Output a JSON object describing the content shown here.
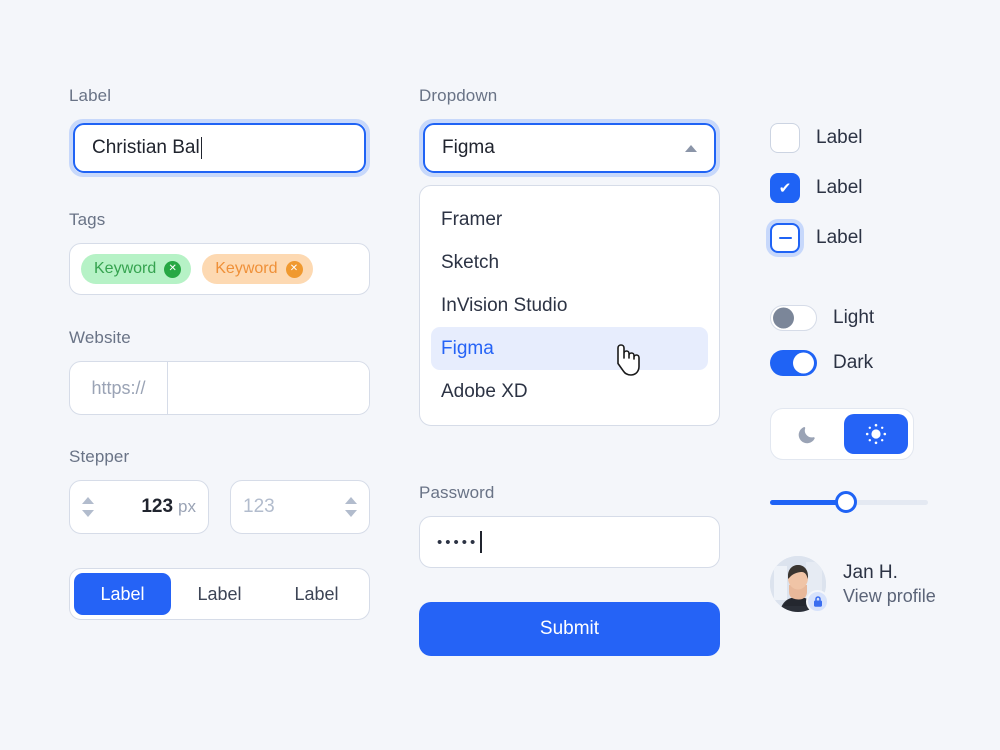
{
  "theme": {
    "accent": "#2563f6",
    "accent_border": "#1f63f5",
    "focus_ring": "#c7d8fb",
    "page_bg": "#f4f6fa",
    "label_color": "#697386",
    "text_color": "#2c3344",
    "tag_green_bg": "#b6f2c6",
    "tag_green_fg": "#35a34f",
    "tag_orange_bg": "#fdd9b2",
    "tag_orange_fg": "#ef9038"
  },
  "left": {
    "label_field": {
      "label": "Label",
      "value": "Christian Bal",
      "focused": true
    },
    "tags": {
      "label": "Tags",
      "items": [
        {
          "text": "Keyword",
          "color": "green",
          "remove_icon": "✕"
        },
        {
          "text": "Keyword",
          "color": "orange",
          "remove_icon": "✕"
        }
      ]
    },
    "website": {
      "label": "Website",
      "prefix": "https://",
      "value": "",
      "placeholder": ""
    },
    "stepper": {
      "label": "Stepper",
      "primary": {
        "value": "123",
        "unit": "px"
      },
      "secondary": {
        "placeholder": "123"
      }
    },
    "segmented": {
      "options": [
        {
          "label": "Label",
          "active": true
        },
        {
          "label": "Label",
          "active": false
        },
        {
          "label": "Label",
          "active": false
        }
      ]
    }
  },
  "middle": {
    "dropdown": {
      "label": "Dropdown",
      "selected": "Figma",
      "expanded": true,
      "caret_icon": "chevron-up-icon",
      "options": [
        {
          "label": "Framer",
          "selected": false
        },
        {
          "label": "Sketch",
          "selected": false
        },
        {
          "label": "InVision Studio",
          "selected": false
        },
        {
          "label": "Figma",
          "selected": true
        },
        {
          "label": "Adobe XD",
          "selected": false
        }
      ]
    },
    "password": {
      "label": "Password",
      "masked_value": "•••••"
    },
    "submit": {
      "label": "Submit"
    }
  },
  "right": {
    "checkboxes": [
      {
        "label": "Label",
        "state": "unchecked"
      },
      {
        "label": "Label",
        "state": "checked",
        "mark": "✔"
      },
      {
        "label": "Label",
        "state": "indeterminate"
      }
    ],
    "toggles": [
      {
        "label": "Light",
        "on": false
      },
      {
        "label": "Dark",
        "on": true
      }
    ],
    "theme_switch": {
      "options": [
        {
          "icon": "moon-icon",
          "active": false
        },
        {
          "icon": "sun-icon",
          "active": true
        }
      ]
    },
    "slider": {
      "percent": 48
    },
    "profile": {
      "name": "Jan H.",
      "action": "View profile",
      "badge_icon": "lock-icon"
    }
  }
}
